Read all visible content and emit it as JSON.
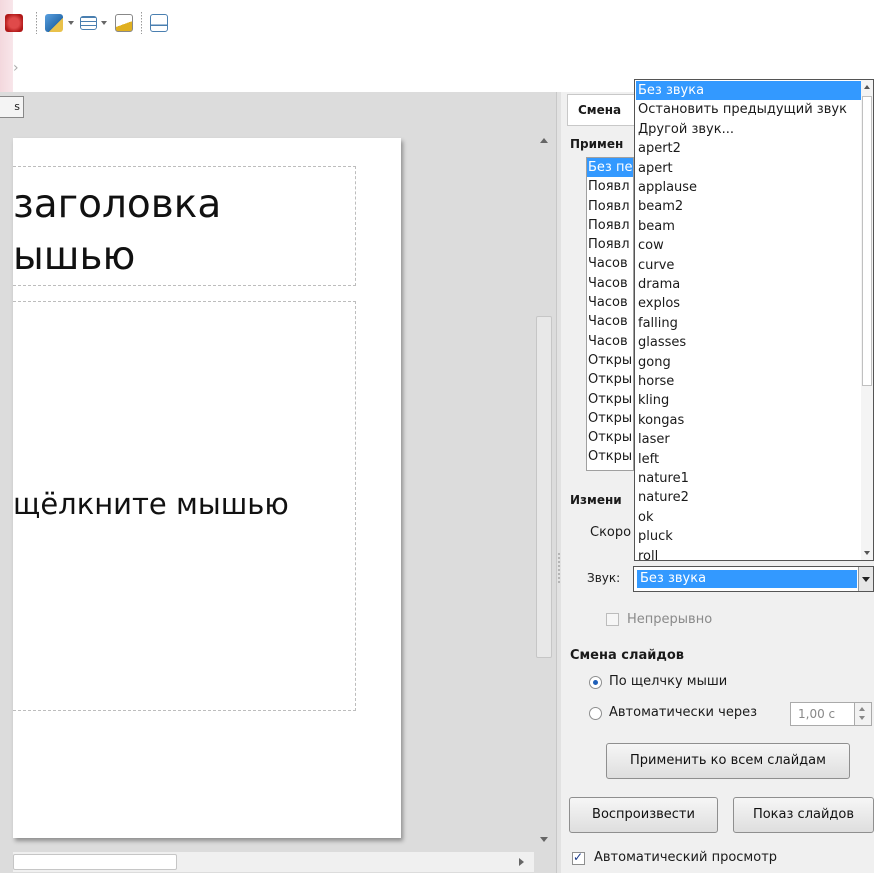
{
  "editor": {
    "tab_stub": "s",
    "title_line1": "заголовка",
    "title_line2": "ышью",
    "content_text": "щёлкните мышью"
  },
  "panel": {
    "header": "Смена",
    "apply_label": "Примен",
    "effects_partial": [
      "Без пе",
      "Появл",
      "Появл",
      "Появл",
      "Появл",
      "Часов",
      "Часов",
      "Часов",
      "Часов",
      "Часов",
      "Откры",
      "Откры",
      "Откры",
      "Откры",
      "Откры",
      "Откры"
    ],
    "modify_label": "Измени",
    "speed_label": "Скоро",
    "sound_label": "Звук:",
    "sound_value": "Без звука",
    "loop_label": "Непрерывно",
    "advance_heading": "Смена слайдов",
    "on_click_label": "По щелчку мыши",
    "auto_after_label": "Автоматически через",
    "auto_after_value": "1,00 с",
    "apply_all_button": "Применить ко всем слайдам",
    "play_button": "Воспроизвести",
    "slideshow_button": "Показ слайдов",
    "autopreview_label": "Автоматический просмотр"
  },
  "sound_dropdown": {
    "items": [
      "Без звука",
      "Остановить предыдущий звук",
      "Другой звук...",
      "apert2",
      "apert",
      "applause",
      "beam2",
      "beam",
      "cow",
      "curve",
      "drama",
      "explos",
      "falling",
      "glasses",
      "gong",
      "horse",
      "kling",
      "kongas",
      "laser",
      "left",
      "nature1",
      "nature2",
      "ok",
      "pluck",
      "roll"
    ],
    "selected": "Без звука"
  },
  "colors": {
    "selection": "#3399ff",
    "panel_bg": "#f0f0f0",
    "workspace_bg": "#dcdcdc"
  },
  "icons": [
    "undo-icon",
    "insert-image-icon",
    "table-icon",
    "chart-icon",
    "slideshow-icon",
    "nav-arrow-icon"
  ]
}
